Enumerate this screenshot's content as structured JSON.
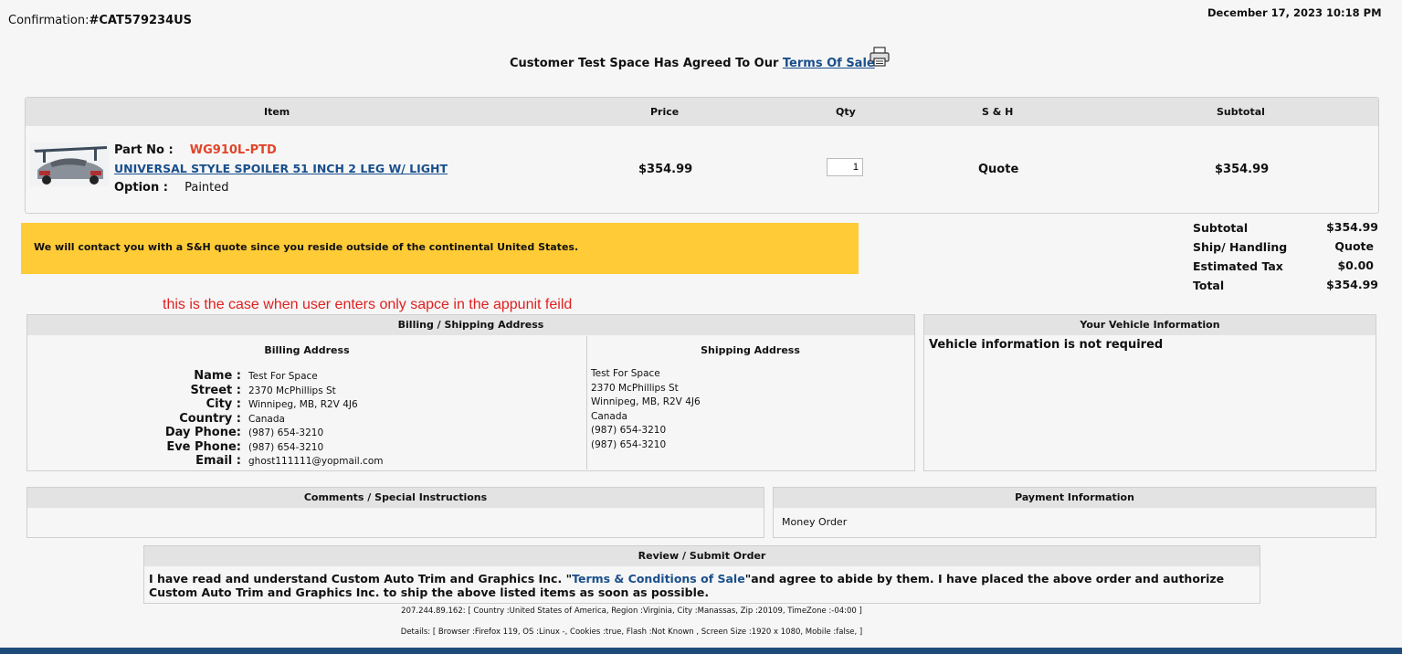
{
  "header": {
    "confirmation_label": "Confirmation:",
    "confirmation_number": "#CAT579234US",
    "datetime": "December 17, 2023 10:18 PM",
    "agreement_prefix": "Customer Test Space Has Agreed To Our ",
    "terms_link": "Terms Of Sale"
  },
  "table": {
    "columns": [
      "Item",
      "Price",
      "Qty",
      "S & H",
      "Subtotal"
    ],
    "item": {
      "part_no_label": "Part No :",
      "part_no": "WG910L-PTD",
      "name": "UNIVERSAL STYLE SPOILER 51 INCH 2 LEG W/ LIGHT",
      "option_label": "Option :",
      "option_value": "Painted",
      "price": "$354.99",
      "qty": "1",
      "sh": "Quote",
      "subtotal": "$354.99"
    }
  },
  "notice": "We will contact you with a S&H quote since you reside outside of the continental United States.",
  "totals": {
    "subtotal_label": "Subtotal",
    "subtotal": "$354.99",
    "ship_label": "Ship/ Handling",
    "ship": "Quote",
    "tax_label": "Estimated Tax",
    "tax": "$0.00",
    "total_label": "Total",
    "total": "$354.99"
  },
  "annotation": "this is the case when user enters only sapce in the appunit feild",
  "billing_shipping": {
    "title": "Billing / Shipping Address",
    "billing_title": "Billing Address",
    "shipping_title": "Shipping Address",
    "labels": {
      "name": "Name :",
      "street": "Street :",
      "city": "City :",
      "country": "Country :",
      "day_phone": "Day Phone:",
      "eve_phone": "Eve Phone:",
      "email": "Email :"
    },
    "billing": {
      "name": "Test For Space",
      "street": "2370 McPhillips St",
      "city": "Winnipeg, MB, R2V 4J6",
      "country": "Canada",
      "day_phone": "(987) 654-3210",
      "eve_phone": "(987) 654-3210",
      "email": "ghost111111@yopmail.com"
    },
    "shipping": {
      "name": "Test For Space",
      "street": "2370 McPhillips St",
      "city": "Winnipeg, MB, R2V 4J6",
      "country": "Canada",
      "day_phone": "(987) 654-3210",
      "eve_phone": "(987) 654-3210"
    }
  },
  "vehicle": {
    "title": "Your Vehicle Information",
    "text": "Vehicle information is not required"
  },
  "comments": {
    "title": "Comments / Special Instructions",
    "text": ""
  },
  "payment": {
    "title": "Payment Information",
    "method": "Money Order"
  },
  "review": {
    "title": "Review / Submit Order",
    "text_before": " I have read and understand Custom Auto Trim and Graphics Inc. \"",
    "terms_link": "Terms & Conditions of Sale",
    "text_after": "\"and agree to abide by them. I have placed the above order and authorize Custom Auto Trim and Graphics Inc. to ship the above listed items as soon as possible."
  },
  "footer": {
    "ip_info": "207.244.89.162: [ Country :United States of America, Region :Virginia, City :Manassas, Zip :20109, TimeZone :-04:00 ]",
    "details": "Details: [ Browser :Firefox 119, OS :Linux -, Cookies :true, Flash :Not Known , Screen Size :1920 x 1080, Mobile :false, ]"
  },
  "colors": {
    "part_no": "#e0452a",
    "link": "#1a4f8b",
    "notice_bg": "#ffcb37",
    "annotation": "#e02020",
    "footer_bar": "#1f4b7a",
    "header_bg": "#e3e3e3"
  },
  "icons": {
    "print": "printer-icon",
    "product": "product-thumbnail"
  }
}
